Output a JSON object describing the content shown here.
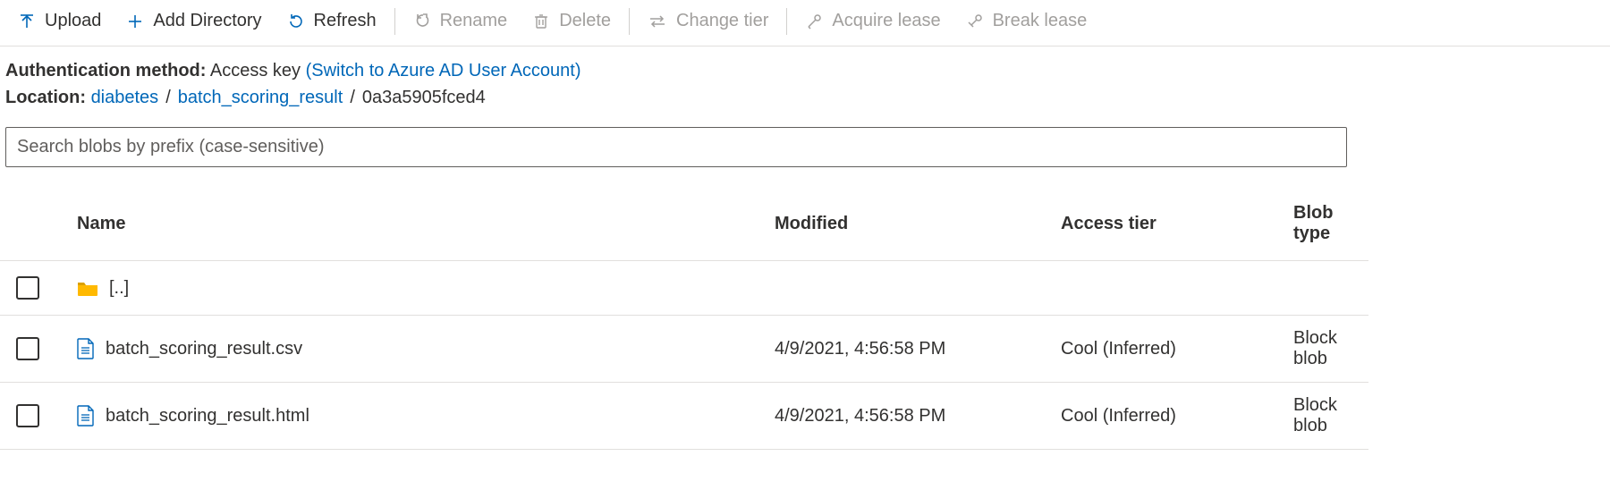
{
  "toolbar": {
    "upload": "Upload",
    "add_directory": "Add Directory",
    "refresh": "Refresh",
    "rename": "Rename",
    "delete": "Delete",
    "change_tier": "Change tier",
    "acquire_lease": "Acquire lease",
    "break_lease": "Break lease"
  },
  "meta": {
    "auth_label": "Authentication method:",
    "auth_value": "Access key",
    "auth_switch": "(Switch to Azure AD User Account)",
    "location_label": "Location:",
    "breadcrumb": [
      "diabetes",
      "batch_scoring_result",
      "0a3a5905fced4"
    ]
  },
  "search": {
    "placeholder": "Search blobs by prefix (case-sensitive)",
    "value": ""
  },
  "table": {
    "headers": {
      "name": "Name",
      "modified": "Modified",
      "access_tier": "Access tier",
      "blob_type": "Blob type"
    },
    "rows": [
      {
        "kind": "up",
        "name": "[..]",
        "modified": "",
        "access_tier": "",
        "blob_type": ""
      },
      {
        "kind": "file",
        "name": "batch_scoring_result.csv",
        "modified": "4/9/2021, 4:56:58 PM",
        "access_tier": "Cool (Inferred)",
        "blob_type": "Block blob"
      },
      {
        "kind": "file",
        "name": "batch_scoring_result.html",
        "modified": "4/9/2021, 4:56:58 PM",
        "access_tier": "Cool (Inferred)",
        "blob_type": "Block blob"
      }
    ]
  },
  "colors": {
    "accent": "#0067b8",
    "text": "#323130",
    "disabled": "#a19f9d"
  }
}
